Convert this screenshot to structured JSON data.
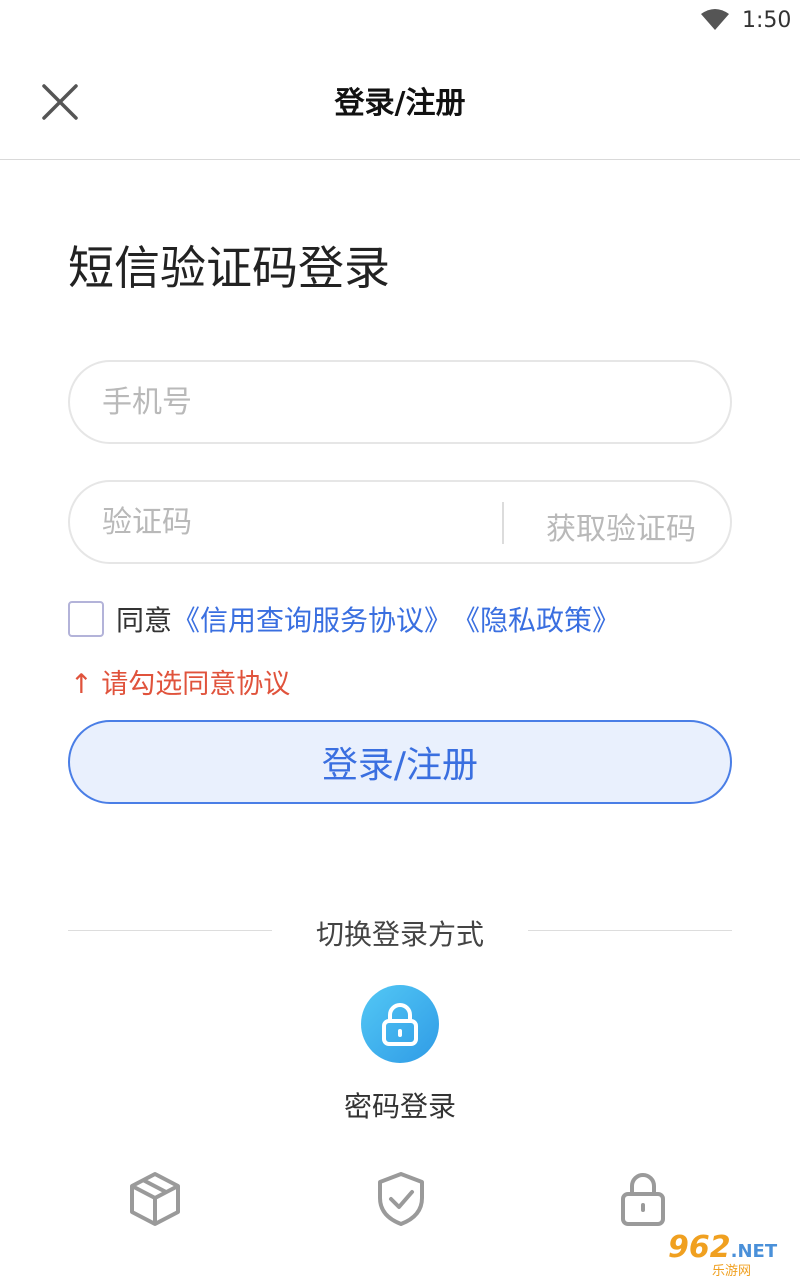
{
  "status": {
    "time": "1:50"
  },
  "nav": {
    "title": "登录/注册"
  },
  "heading": "短信验证码登录",
  "phone": {
    "placeholder": "手机号",
    "value": ""
  },
  "code": {
    "placeholder": "验证码",
    "value": "",
    "get_code_label": "获取验证码"
  },
  "agreement": {
    "prefix": "同意",
    "service_link": "《信用查询服务协议》",
    "privacy_link": "《隐私政策》",
    "checked": false
  },
  "warning": "↑ 请勾选同意协议",
  "login_button": "登录/注册",
  "switch": {
    "label": "切换登录方式",
    "password_login": "密码登录"
  },
  "watermark": {
    "main": "962",
    "net": ".NET",
    "sub": "乐游网"
  },
  "colors": {
    "accent": "#3a6fe0",
    "warning": "#e0533c",
    "icon_gradient_start": "#53c8f5",
    "icon_gradient_end": "#2f9be6"
  }
}
